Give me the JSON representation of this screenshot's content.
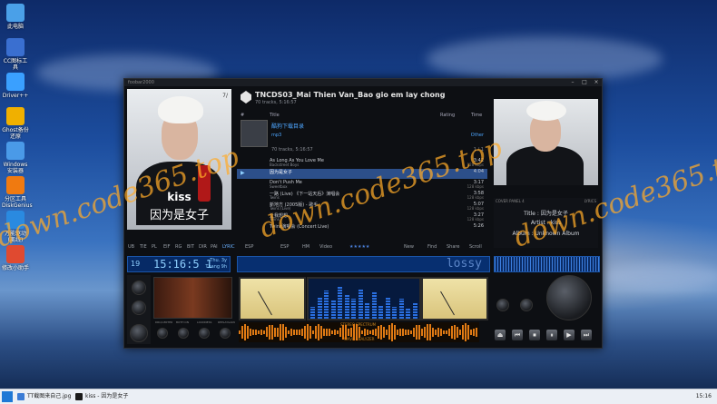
{
  "desktop": {
    "icons": [
      {
        "label": "此电脑",
        "icon": "computer-icon",
        "color": "#4aa0e8"
      },
      {
        "label": "CC图标工具",
        "icon": "cc-icon",
        "color": "#3a6fd0"
      },
      {
        "label": "Driver++",
        "icon": "gear-icon",
        "color": "#3aa0ff"
      },
      {
        "label": "Ghost备份还原",
        "icon": "ghost-icon",
        "color": "#f0b000"
      },
      {
        "label": "Windows安装器",
        "icon": "windows-installer-icon",
        "color": "#4a9ae8"
      },
      {
        "label": "分区工具DiskGenius",
        "icon": "disk-icon",
        "color": "#f07a10"
      },
      {
        "label": "万能驱动(离线)",
        "icon": "driver-icon",
        "color": "#2a8ae0"
      },
      {
        "label": "修改小助手",
        "icon": "lifebuoy-icon",
        "color": "#e04a30"
      }
    ],
    "watermark": "down.code365.top"
  },
  "player": {
    "window_title": "foobar2000",
    "window_buttons": [
      "–",
      "□",
      "×"
    ],
    "album_name": "kiss",
    "album_subtitle": "因为是女子",
    "album_badge": "7/",
    "playlist_title": "TNCDS03_Mai Thien Van_Bao gio em lay chong",
    "playlist_sub": "70 tracks, 5:16:57",
    "columns": {
      "index": "#",
      "title": "Title",
      "rating": "Rating",
      "time": "Time"
    },
    "group": {
      "name": "酷狗下载目录",
      "sub": "mp3",
      "genre": "Other"
    },
    "group2_sub": "70 tracks, 5:16:57",
    "group2_count": "1 / 1",
    "rows": [
      {
        "title": "As Long As You Love Me",
        "artist": "Backstreet Boys",
        "time": "3:42",
        "meta": "128 kbps"
      },
      {
        "title": "因为是女子",
        "artist": "",
        "time": "4:04",
        "meta": "",
        "selected": true
      },
      {
        "title": "Don't Push Me",
        "artist": "Sweetbox",
        "time": "3:17",
        "meta": "128 kbps"
      },
      {
        "title": "一路 (Live) 《下一站天后》演唱会",
        "artist": "Twins",
        "time": "3:58",
        "meta": "128 kbps"
      },
      {
        "title": "新地方 (2005版) - 歌手",
        "artist": "Twins (Live)",
        "time": "5:07",
        "meta": "128 kbps"
      },
      {
        "title": "让我想想",
        "artist": "Twins",
        "time": "3:27",
        "meta": "128 kbps"
      },
      {
        "title": "Twins演唱会 (Concert Live)",
        "artist": "",
        "time": "5:26",
        "meta": ""
      }
    ],
    "left_tabs": [
      "UB",
      "TIE",
      "PL",
      "EIF",
      "RG",
      "BIT",
      "DIR",
      "PAI",
      "LYRIC"
    ],
    "mid_tabs": [
      "ESP",
      "ESP",
      "HM",
      "Video",
      "New",
      "Find",
      "Share",
      "Scroll"
    ],
    "rating_stars": "★★★★★",
    "lcd_track": "19",
    "lcd_time": "15:16:5 1",
    "lcd_day": "Thu. 3y",
    "lcd_month": "Thang 9h",
    "lossy_label": "lossy",
    "cover_panel_label": "COVER PANEL 4",
    "cover_panel_right": "LYRICS",
    "info_title": "Title : 因为是女子",
    "info_artist": "Artist : kiss",
    "info_album": "Album : Unknown Album",
    "knob_labels": [
      "BALANCE",
      "DEVICE",
      "VOLUME"
    ],
    "dsp_labels": [
      "DRC/LIMITER",
      "BOTH ON",
      "LOUDNESS",
      "REPLAYGAIN"
    ],
    "wave_label": "STEREO SPECTRUM",
    "wave_sub": "WAVE ANALYZER",
    "controls": [
      "⏏",
      "⏮",
      "⏹",
      "⏸",
      "▶",
      "⏭"
    ]
  },
  "taskbar": {
    "tasks": [
      {
        "label": "TT截图来自己.jpg",
        "icon": "image-icon",
        "color": "#3a7bd5"
      },
      {
        "label": "kiss - 因为是女子",
        "icon": "foobar-icon",
        "color": "#1a1a1a"
      }
    ],
    "clock": "15:16"
  }
}
